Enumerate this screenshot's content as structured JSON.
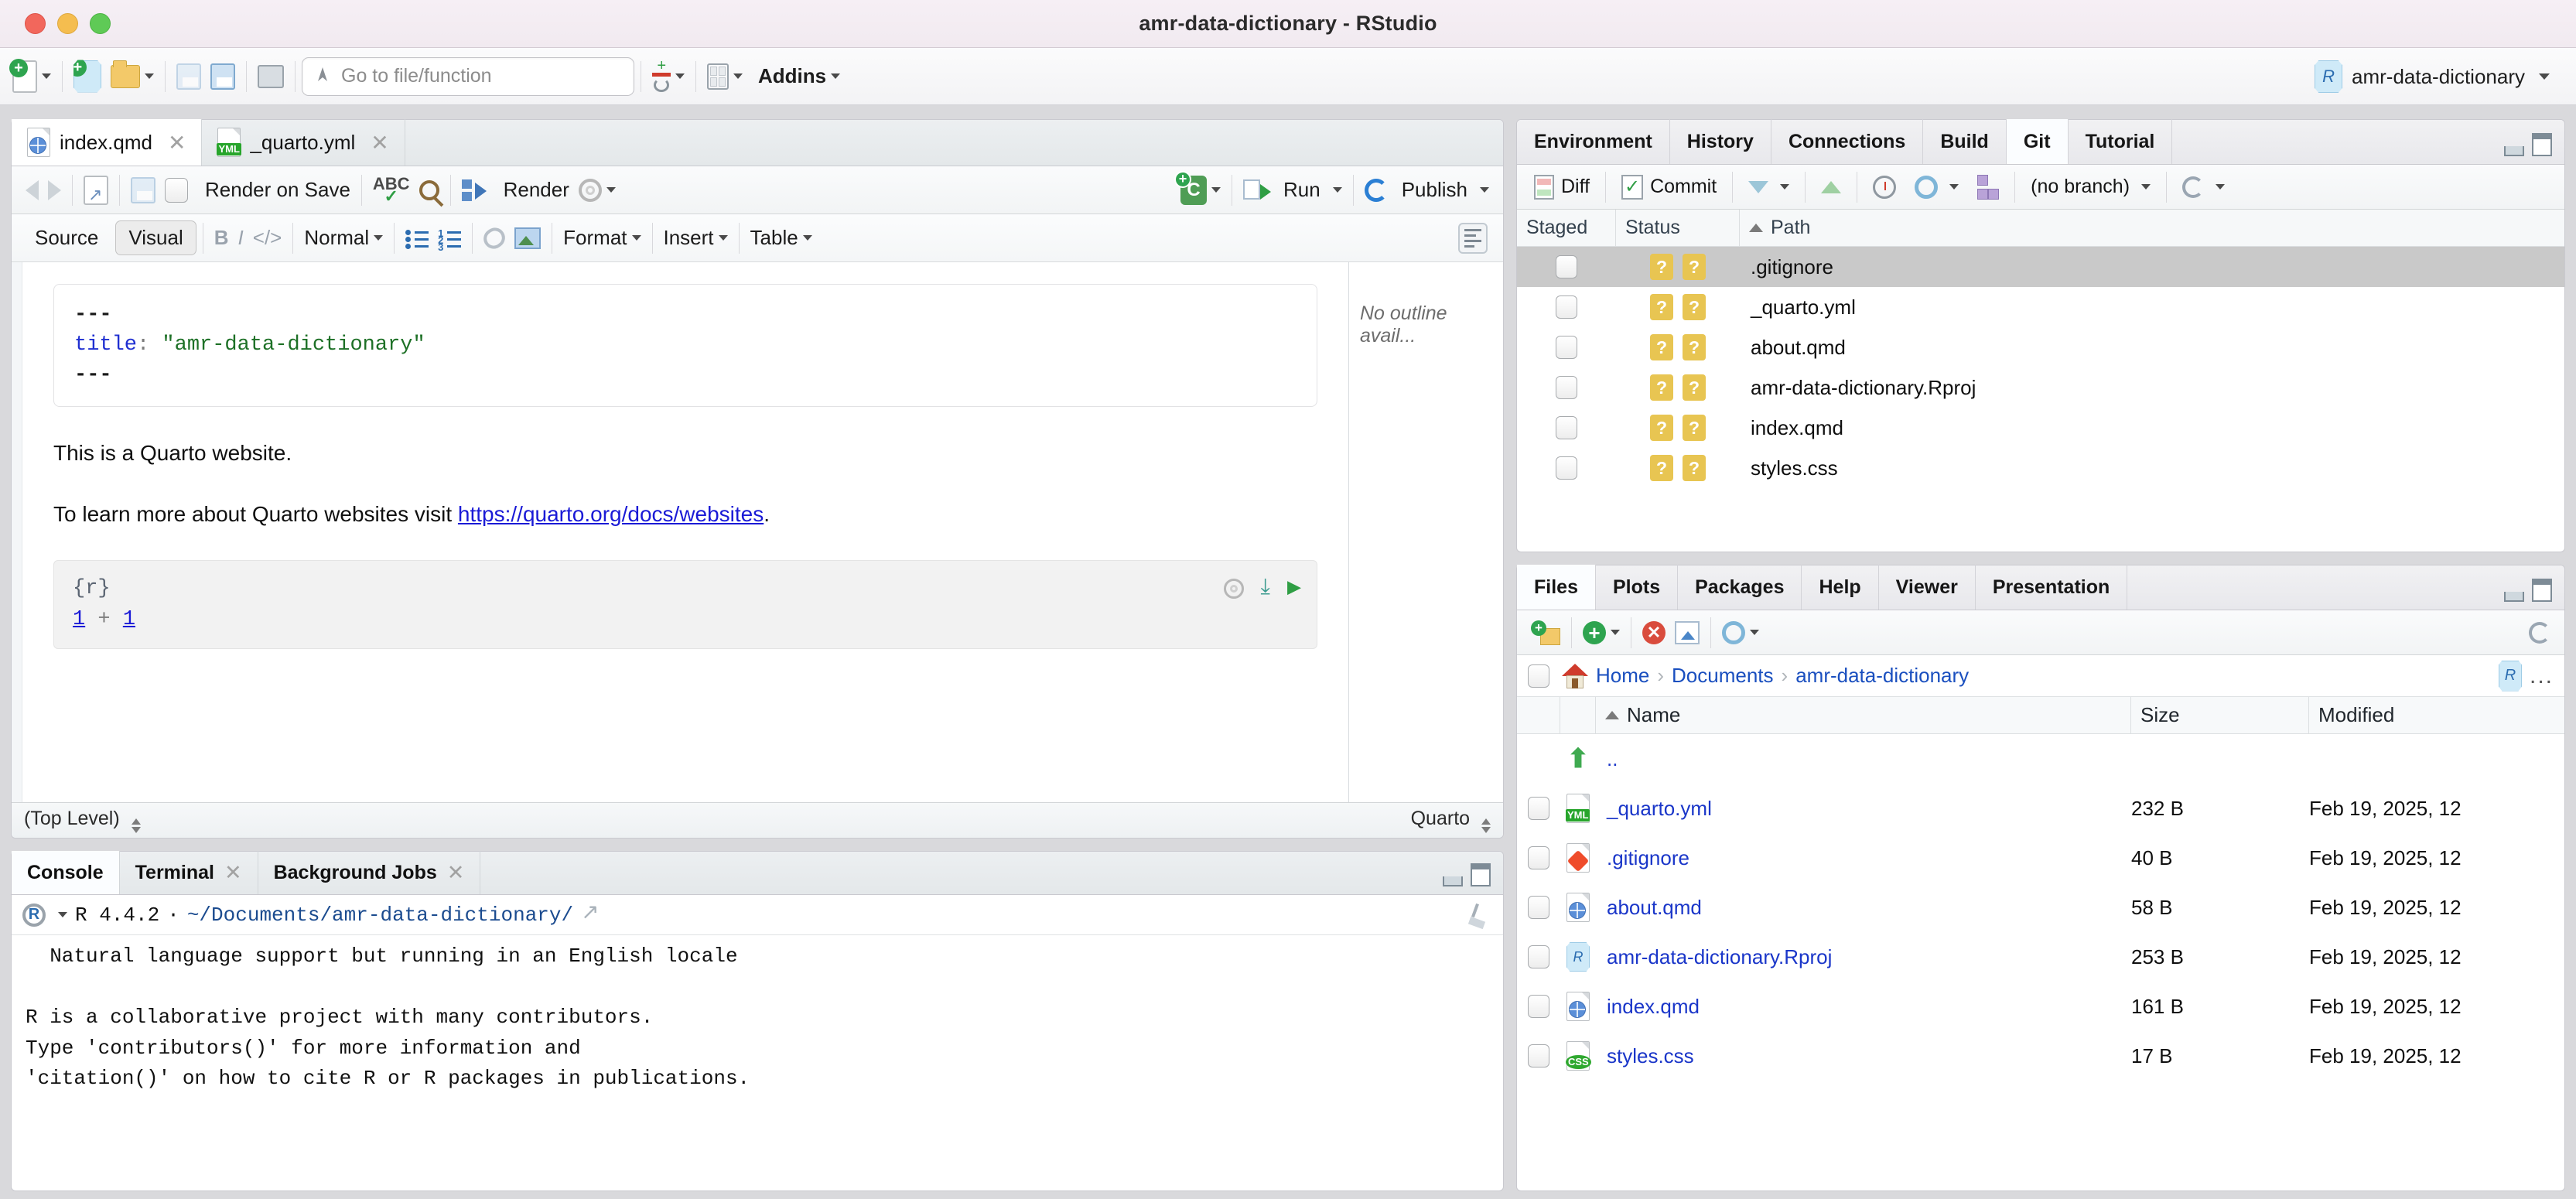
{
  "window": {
    "title": "amr-data-dictionary - RStudio",
    "traffic_lights": [
      "close",
      "minimize",
      "zoom"
    ]
  },
  "main_toolbar": {
    "new_file_icon": "new-file-icon",
    "new_project_icon": "new-project-icon",
    "open_file_icon": "open-file-icon",
    "save_icon": "save-icon",
    "save_all_icon": "save-all-icon",
    "print_icon": "print-icon",
    "goto_placeholder": "Go to file/function",
    "goto_value": "",
    "version_control_icon": "version-control-icon",
    "workspace_panes_icon": "workspace-panes-icon",
    "addins_label": "Addins",
    "project_name": "amr-data-dictionary"
  },
  "source_pane": {
    "tabs": [
      {
        "label": "index.qmd",
        "icon": "quarto-file-icon",
        "active": true,
        "closable": true
      },
      {
        "label": "_quarto.yml",
        "icon": "yml-file-icon",
        "active": false,
        "closable": true
      }
    ],
    "toolbar": {
      "back_icon": "back-arrow-icon",
      "forward_icon": "forward-arrow-icon",
      "popout_icon": "show-in-new-window-icon",
      "save_icon": "save-icon",
      "render_on_save_label": "Render on Save",
      "render_on_save_checked": false,
      "spellcheck_icon": "spellcheck-icon",
      "find_icon": "find-replace-icon",
      "render_label": "Render",
      "render_options_icon": "gear-icon",
      "insert_chunk_icon": "insert-chunk-icon",
      "run_label": "Run",
      "publish_label": "Publish"
    },
    "visual_toolbar": {
      "source_label": "Source",
      "visual_label": "Visual",
      "visual_active": true,
      "bold_label": "B",
      "italic_label": "I",
      "code_label": "</>",
      "block_format": "Normal",
      "bullet_list_icon": "bullet-list-icon",
      "numbered_list_icon": "numbered-list-icon",
      "link_icon": "link-icon",
      "image_icon": "insert-image-icon",
      "format_label": "Format",
      "insert_label": "Insert",
      "table_label": "Table",
      "outline_toggle_icon": "document-outline-icon"
    },
    "document": {
      "yaml": {
        "open_fence": "---",
        "key": "title",
        "colon": ":",
        "value": "\"amr-data-dictionary\"",
        "close_fence": "---"
      },
      "paragraph_1": "This is a Quarto website.",
      "paragraph_2_prefix": "To learn more about Quarto websites visit ",
      "link_text": "https://quarto.org/docs/websites",
      "paragraph_2_suffix": ".",
      "chunk": {
        "header": "{r}",
        "code_left": "1",
        "code_op": "+",
        "code_right": "1",
        "settings_icon": "gear-icon",
        "run_above_icon": "run-all-chunks-above-icon",
        "run_chunk_icon": "run-current-chunk-icon"
      }
    },
    "outline": {
      "empty_message": "No outline avail..."
    },
    "status_bar": {
      "scope_label": "(Top Level)",
      "doc_type_label": "Quarto"
    }
  },
  "console_pane": {
    "tabs": [
      {
        "label": "Console",
        "active": true,
        "closable": false
      },
      {
        "label": "Terminal",
        "active": false,
        "closable": true
      },
      {
        "label": "Background Jobs",
        "active": false,
        "closable": true
      }
    ],
    "session": {
      "r_badge": "R",
      "version_label": "R 4.4.2",
      "separator": "·",
      "working_directory": "~/Documents/amr-data-dictionary/",
      "popout_icon": "open-in-new-window-icon",
      "clear_icon": "clear-console-icon"
    },
    "output_lines": [
      "  Natural language support but running in an English locale",
      "",
      "R is a collaborative project with many contributors.",
      "Type 'contributors()' for more information and",
      "'citation()' on how to cite R or R packages in publications."
    ]
  },
  "right_top_pane": {
    "tabs": [
      {
        "label": "Environment",
        "active": false
      },
      {
        "label": "History",
        "active": false
      },
      {
        "label": "Connections",
        "active": false
      },
      {
        "label": "Build",
        "active": false
      },
      {
        "label": "Git",
        "active": true
      },
      {
        "label": "Tutorial",
        "active": false
      }
    ],
    "toolbar": {
      "diff_label": "Diff",
      "commit_label": "Commit",
      "pull_icon": "pull-icon",
      "push_icon": "push-icon",
      "history_icon": "history-clock-icon",
      "more_icon": "git-more-gear-icon",
      "branch_icon": "new-branch-icon",
      "branch_label": "(no branch)",
      "refresh_icon": "refresh-icon"
    },
    "columns": [
      "Staged",
      "Status",
      "Path"
    ],
    "sort_column": "Path",
    "rows": [
      {
        "staged": false,
        "status": [
          "?",
          "?"
        ],
        "path": ".gitignore",
        "selected": true
      },
      {
        "staged": false,
        "status": [
          "?",
          "?"
        ],
        "path": "_quarto.yml",
        "selected": false
      },
      {
        "staged": false,
        "status": [
          "?",
          "?"
        ],
        "path": "about.qmd",
        "selected": false
      },
      {
        "staged": false,
        "status": [
          "?",
          "?"
        ],
        "path": "amr-data-dictionary.Rproj",
        "selected": false
      },
      {
        "staged": false,
        "status": [
          "?",
          "?"
        ],
        "path": "index.qmd",
        "selected": false
      },
      {
        "staged": false,
        "status": [
          "?",
          "?"
        ],
        "path": "styles.css",
        "selected": false
      }
    ]
  },
  "right_bottom_pane": {
    "tabs": [
      {
        "label": "Files",
        "active": true
      },
      {
        "label": "Plots",
        "active": false
      },
      {
        "label": "Packages",
        "active": false
      },
      {
        "label": "Help",
        "active": false
      },
      {
        "label": "Viewer",
        "active": false
      },
      {
        "label": "Presentation",
        "active": false
      }
    ],
    "toolbar": {
      "new_folder_icon": "new-folder-icon",
      "new_blank_file_icon": "new-blank-file-icon",
      "delete_icon": "delete-icon",
      "rename_icon": "rename-icon",
      "more_icon": "more-gear-icon",
      "refresh_icon": "refresh-icon"
    },
    "breadcrumb": {
      "home_icon": "home-icon",
      "crumbs": [
        "Home",
        "Documents",
        "amr-data-dictionary"
      ],
      "separator": "›",
      "rproj_icon": "rproject-icon",
      "overflow_label": "..."
    },
    "columns": [
      "",
      "",
      "Name",
      "Size",
      "Modified"
    ],
    "sort_column": "Name",
    "rows": [
      {
        "icon": "up-directory-icon",
        "name": "..",
        "size": "",
        "modified": "",
        "has_checkbox": false
      },
      {
        "icon": "yml-file-icon",
        "name": "_quarto.yml",
        "size": "232 B",
        "modified": "Feb 19, 2025, 12",
        "has_checkbox": true
      },
      {
        "icon": "git-file-icon",
        "name": ".gitignore",
        "size": "40 B",
        "modified": "Feb 19, 2025, 12",
        "has_checkbox": true
      },
      {
        "icon": "quarto-file-icon",
        "name": "about.qmd",
        "size": "58 B",
        "modified": "Feb 19, 2025, 12",
        "has_checkbox": true
      },
      {
        "icon": "rproject-icon",
        "name": "amr-data-dictionary.Rproj",
        "size": "253 B",
        "modified": "Feb 19, 2025, 12",
        "has_checkbox": true
      },
      {
        "icon": "quarto-file-icon",
        "name": "index.qmd",
        "size": "161 B",
        "modified": "Feb 19, 2025, 12",
        "has_checkbox": true
      },
      {
        "icon": "css-file-icon",
        "name": "styles.css",
        "size": "17 B",
        "modified": "Feb 19, 2025, 12",
        "has_checkbox": true
      }
    ]
  },
  "colors": {
    "titlebar": "#f4edf3",
    "accent_blue": "#1a36c9",
    "git_status_yellow": "#e8c552",
    "selection_gray": "#c9c9c9",
    "link_blue": "#1a1ad6",
    "yaml_key_blue": "#1f2fd1",
    "yaml_value_green": "#1d7026"
  }
}
